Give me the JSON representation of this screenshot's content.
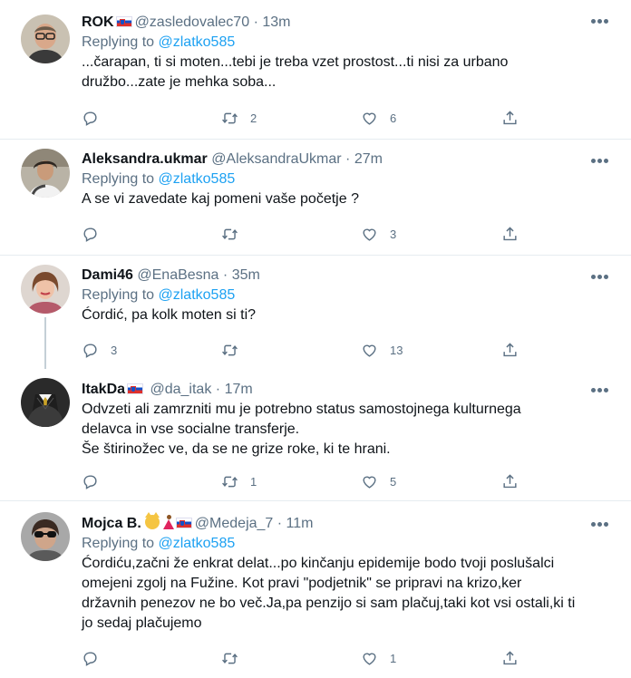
{
  "tweets": [
    {
      "name": "ROK",
      "flags": "si",
      "handle": "@zasledovalec70",
      "dot": "·",
      "time": "13m",
      "replying_prefix": "Replying to ",
      "replying_to": "@zlatko585",
      "text": "...čarapan, ti si moten...tebi je treba vzet prostost...ti nisi za urbano\ndružbo...zate je mehka soba...",
      "replies": "",
      "retweets": "2",
      "likes": "6"
    },
    {
      "name": "Aleksandra.ukmar",
      "handle": "@AleksandraUkmar",
      "dot": "·",
      "time": "27m",
      "replying_prefix": "Replying to ",
      "replying_to": "@zlatko585",
      "text": "A se vi zavedate kaj pomeni vaše početje ?",
      "replies": "",
      "retweets": "",
      "likes": "3"
    },
    {
      "name": "Dami46",
      "handle": "@EnaBesna",
      "dot": "·",
      "time": "35m",
      "replying_prefix": "Replying to ",
      "replying_to": "@zlatko585",
      "text": "Ćordić, pa kolk moten si ti?",
      "replies": "3",
      "retweets": "",
      "likes": "13"
    },
    {
      "name": "ItakDa",
      "handle": "@da_itak",
      "dot": "·",
      "time": "17m",
      "text": "Odvzeti ali zamrzniti mu je potrebno status samostojnega kulturnega\ndelavca in vse socialne transferje.\nŠe štirinožec ve, da se ne grize roke, ki te hrani.",
      "replies": "",
      "retweets": "1",
      "likes": "5"
    },
    {
      "name": "Mojca B.",
      "handle": "@Medeja_7",
      "dot": "·",
      "time": "11m",
      "replying_prefix": "Replying to ",
      "replying_to": "@zlatko585",
      "text": "Ćordiću,začni že enkrat delat...po kinčanju epidemije bodo tvoji poslušalci\nomejeni zgolj na Fužine. Kot pravi \"podjetnik\" se pripravi na krizo,ker\ndržavnih penezov ne bo več.Ja,pa penzijo si sam plačuj,taki kot vsi ostali,ki ti\njo sedaj plačujemo",
      "replies": "",
      "retweets": "",
      "likes": "1"
    }
  ],
  "icons": {
    "reply": "reply-icon",
    "retweet": "retweet-icon",
    "like": "like-icon",
    "share": "share-icon",
    "more": "more-icon"
  },
  "colors": {
    "link": "#1da1f2",
    "secondary": "#5b7083",
    "text": "#0f1419",
    "divider": "#e6ecf0"
  }
}
